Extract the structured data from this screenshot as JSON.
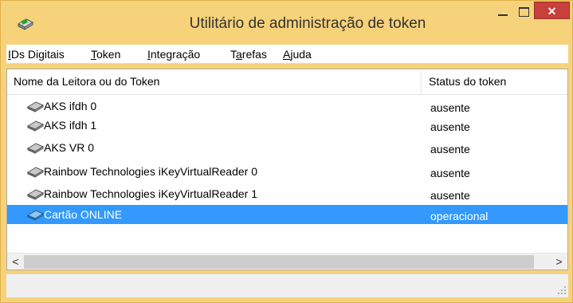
{
  "window": {
    "title": "Utilitário de administração de token",
    "icon": "token-app-icon",
    "close_glyph": "✕",
    "colors": {
      "titlebar": "#f6d27a",
      "close_button": "#c8403a",
      "selection": "#3399ff"
    }
  },
  "menu": {
    "items": [
      {
        "accel": "I",
        "rest": "Ds Digitais"
      },
      {
        "accel": "T",
        "rest": "oken"
      },
      {
        "accel": "I",
        "rest": "ntegração"
      },
      {
        "pre": "T",
        "accel": "a",
        "rest": "refas"
      },
      {
        "accel": "A",
        "rest": "juda"
      }
    ]
  },
  "table": {
    "columns": [
      "Nome da Leitora ou do Token",
      "Status do token"
    ],
    "rows": [
      {
        "name": "AKS ifdh 0",
        "status": "ausente",
        "icon": "card-reader-gray-icon"
      },
      {
        "name": "AKS ifdh 1",
        "status": "ausente",
        "icon": "card-reader-gray-icon"
      },
      {
        "name": "AKS VR 0",
        "status": "ausente",
        "icon": "card-reader-gray-icon"
      },
      {
        "name": "Rainbow Technologies iKeyVirtualReader 0",
        "status": "ausente",
        "icon": "card-reader-gray-icon"
      },
      {
        "name": "Rainbow Technologies iKeyVirtualReader 1",
        "status": "ausente",
        "icon": "card-reader-gray-icon"
      },
      {
        "name": "Cartão ONLINE",
        "status": "operacional",
        "icon": "card-reader-blue-icon",
        "selected": true
      }
    ]
  },
  "scrollbar": {
    "left_glyph": "<",
    "right_glyph": ">"
  }
}
